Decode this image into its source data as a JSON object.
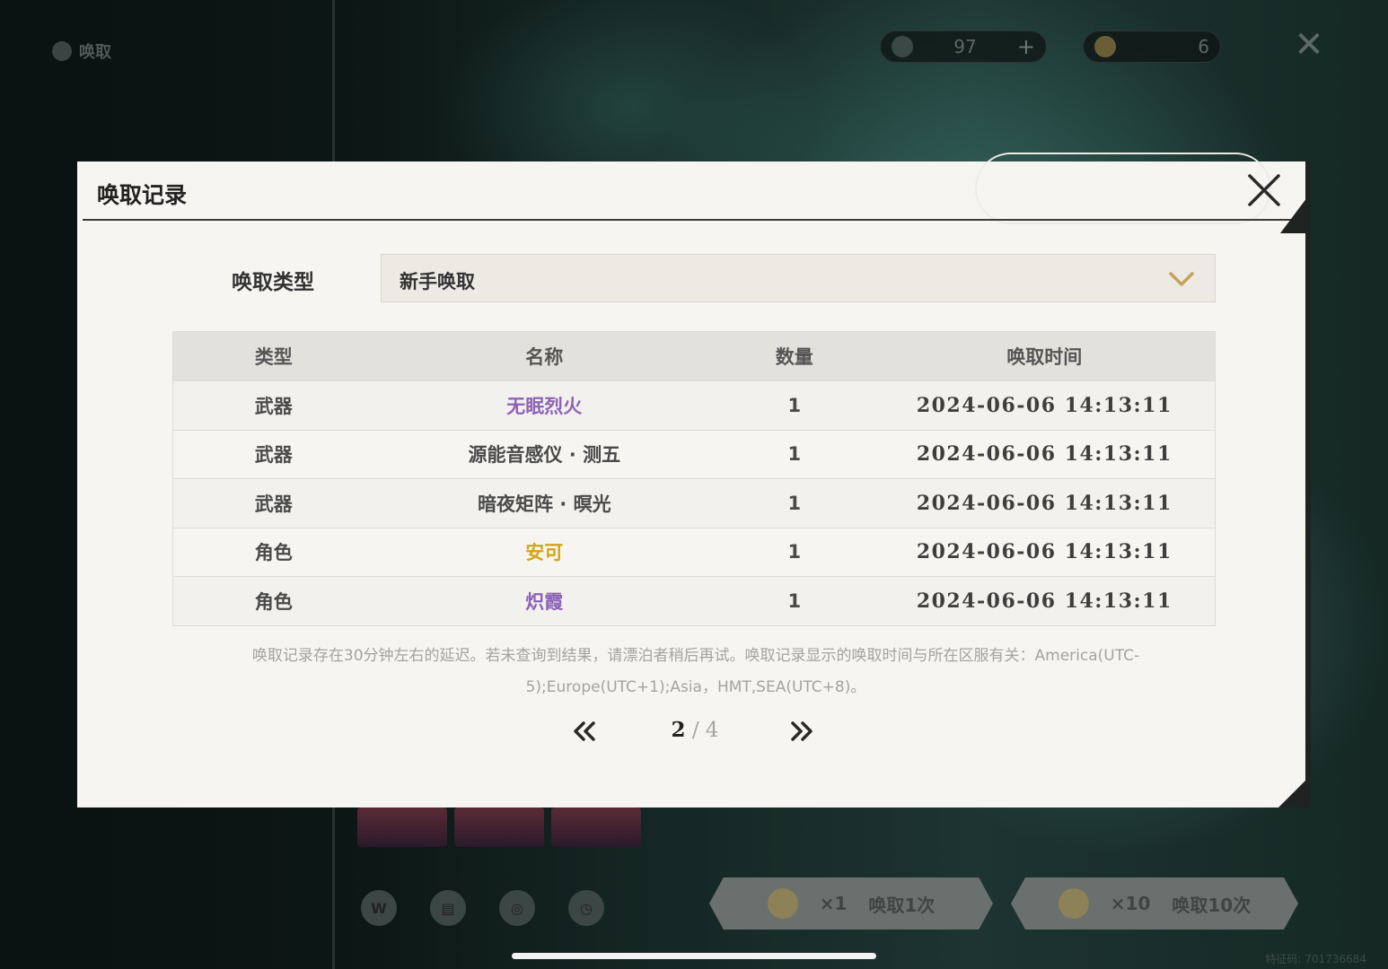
{
  "background": {
    "back_label": "唤取",
    "currency_a_value": "97",
    "currency_b_value": "6",
    "summon_one": {
      "cost": "×1",
      "label": "唤取1次"
    },
    "summon_ten": {
      "cost": "×10",
      "label": "唤取10次"
    },
    "uid_watermark": "特征码: 701736684"
  },
  "modal": {
    "title": "唤取记录",
    "type_label": "唤取类型",
    "type_selected": "新手唤取",
    "columns": [
      "类型",
      "名称",
      "数量",
      "唤取时间"
    ],
    "rows": [
      {
        "type": "武器",
        "name": "无眠烈火",
        "qty": "1",
        "time": "2024-06-06 14:13:11",
        "rarity_color": "#8e63b5"
      },
      {
        "type": "武器",
        "name": "源能音感仪 · 测五",
        "qty": "1",
        "time": "2024-06-06 14:13:11",
        "rarity_color": "#4a4a4a"
      },
      {
        "type": "武器",
        "name": "暗夜矩阵 · 暝光",
        "qty": "1",
        "time": "2024-06-06 14:13:11",
        "rarity_color": "#4a4a4a"
      },
      {
        "type": "角色",
        "name": "安可",
        "qty": "1",
        "time": "2024-06-06 14:13:11",
        "rarity_color": "#d2a618"
      },
      {
        "type": "角色",
        "name": "炽霞",
        "qty": "1",
        "time": "2024-06-06 14:13:11",
        "rarity_color": "#8e63b5"
      }
    ],
    "note": "唤取记录存在30分钟左右的延迟。若未查询到结果，请漂泊者稍后再试。唤取记录显示的唤取时间与所在区服有关：America(UTC-5);Europe(UTC+1);Asia，HMT,SEA(UTC+8)。",
    "pager": {
      "current": "2",
      "separator": "/",
      "total": "4"
    }
  }
}
